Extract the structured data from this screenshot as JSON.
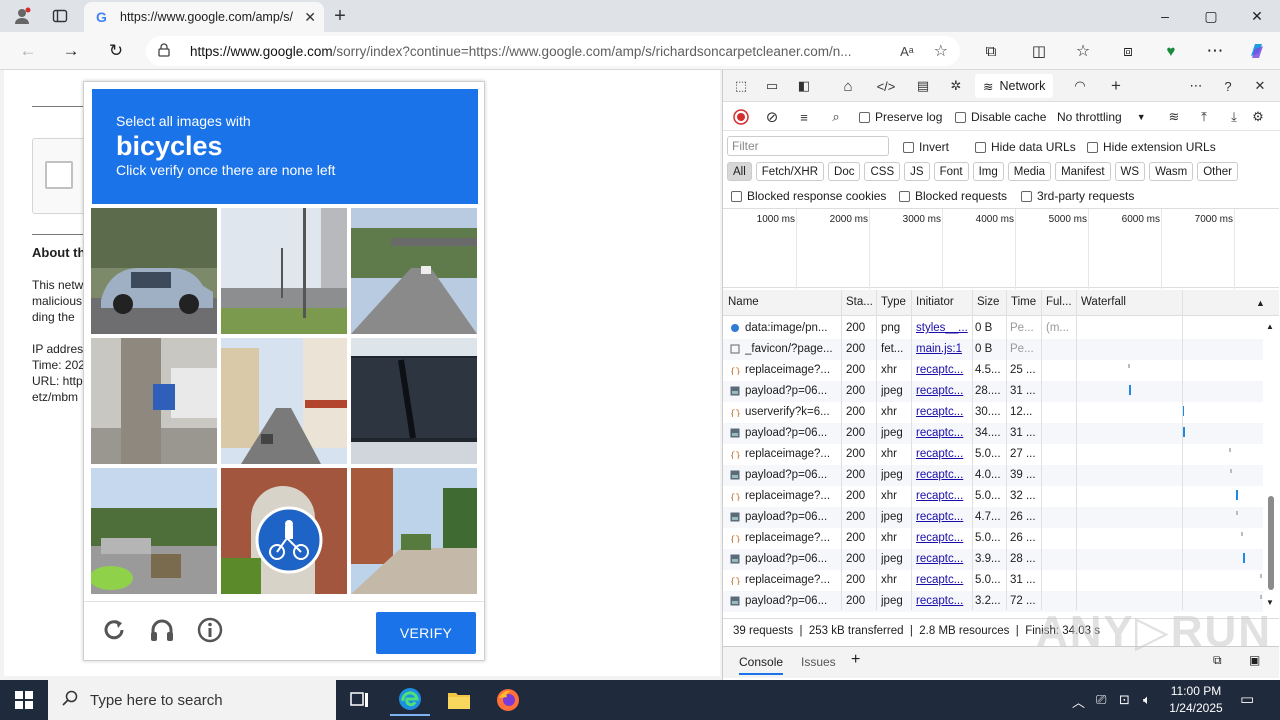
{
  "browser": {
    "tab_title": "https://www.google.com/amp/s/",
    "tab_favicon": "G",
    "url_domain": "https://www.google.com",
    "url_path": "/sorry/index?continue=https://www.google.com/amp/s/richardsoncarpetcleaner.com/n...",
    "read_aloud": "Aᵃ",
    "window_min": "–",
    "window_max": "▢",
    "window_close": "✕"
  },
  "page": {
    "heading": "About th",
    "lines": [
      "This netw",
      "malicious",
      "ding the",
      "",
      "IP addres",
      "Time: 202",
      "URL: http",
      "etz/mbm"
    ]
  },
  "captcha": {
    "instruction": "Select all images with",
    "target": "bicycles",
    "hint": "Click verify once there are none left",
    "verify_label": "VERIFY"
  },
  "devtools": {
    "network_tab": "Network",
    "preserve_log": "Preserve log",
    "disable_cache": "Disable cache",
    "throttling": "No throttling",
    "filter_placeholder": "Filter",
    "invert": "Invert",
    "hide_data_urls": "Hide data URLs",
    "hide_extension_urls": "Hide extension URLs",
    "types": [
      "All",
      "Fetch/XHR",
      "Doc",
      "CSS",
      "JS",
      "Font",
      "Img",
      "Media",
      "Manifest",
      "WS",
      "Wasm",
      "Other"
    ],
    "blocked_response_cookies": "Blocked response cookies",
    "blocked_requests": "Blocked requests",
    "third_party": "3rd-party requests",
    "timeline": [
      "1000 ms",
      "2000 ms",
      "3000 ms",
      "4000 ms",
      "5000 ms",
      "6000 ms",
      "7000 ms"
    ],
    "columns": [
      "Name",
      "Sta...",
      "Type",
      "Initiator",
      "Size",
      "Time",
      "Ful...",
      "Waterfall"
    ],
    "rows": [
      {
        "name": "data:image/pn...",
        "status": "200",
        "type": "png",
        "initiator": "styles__...",
        "size": "0 B",
        "time": "Pe...",
        "full": "(m...",
        "icon": "data"
      },
      {
        "name": "_favicon/?page...",
        "status": "200",
        "type": "fet...",
        "initiator": "main.js:1",
        "size": "0 B",
        "time": "Pe...",
        "full": "",
        "icon": "doc"
      },
      {
        "name": "replaceimage?...",
        "status": "200",
        "type": "xhr",
        "initiator": "recaptc...",
        "size": "4.5...",
        "time": "25 ...",
        "full": "",
        "icon": "xhr"
      },
      {
        "name": "payload?p=06...",
        "status": "200",
        "type": "jpeg",
        "initiator": "recaptc...",
        "size": "28....",
        "time": "31 ...",
        "full": "",
        "icon": "img"
      },
      {
        "name": "userverify?k=6...",
        "status": "200",
        "type": "xhr",
        "initiator": "recaptc...",
        "size": "30....",
        "time": "12...",
        "full": "",
        "icon": "xhr"
      },
      {
        "name": "payload?p=06...",
        "status": "200",
        "type": "jpeg",
        "initiator": "recaptc...",
        "size": "34....",
        "time": "31 ...",
        "full": "",
        "icon": "img"
      },
      {
        "name": "replaceimage?...",
        "status": "200",
        "type": "xhr",
        "initiator": "recaptc...",
        "size": "5.0...",
        "time": "27 ...",
        "full": "",
        "icon": "xhr"
      },
      {
        "name": "payload?p=06...",
        "status": "200",
        "type": "jpeg",
        "initiator": "recaptc...",
        "size": "4.0...",
        "time": "39 ...",
        "full": "",
        "icon": "img"
      },
      {
        "name": "replaceimage?...",
        "status": "200",
        "type": "xhr",
        "initiator": "recaptc...",
        "size": "5.0...",
        "time": "32 ...",
        "full": "",
        "icon": "xhr"
      },
      {
        "name": "payload?p=06...",
        "status": "200",
        "type": "jpeg",
        "initiator": "recaptc...",
        "size": "4.7...",
        "time": "26 ...",
        "full": "",
        "icon": "img"
      },
      {
        "name": "replaceimage?...",
        "status": "200",
        "type": "xhr",
        "initiator": "recaptc...",
        "size": "5.0...",
        "time": "26 ...",
        "full": "",
        "icon": "xhr"
      },
      {
        "name": "payload?p=06...",
        "status": "200",
        "type": "jpeg",
        "initiator": "recaptc...",
        "size": "3.9...",
        "time": "28 ...",
        "full": "",
        "icon": "img"
      },
      {
        "name": "replaceimage?...",
        "status": "200",
        "type": "xhr",
        "initiator": "recaptc...",
        "size": "5.0...",
        "time": "31 ...",
        "full": "",
        "icon": "xhr"
      },
      {
        "name": "payload?p=06...",
        "status": "200",
        "type": "jpeg",
        "initiator": "recaptc...",
        "size": "3.2...",
        "time": "72 ...",
        "full": "",
        "icon": "img"
      }
    ],
    "status_requests": "39 requests",
    "status_transferred": "253 kB transferred",
    "status_resources": "2.8 MB resources",
    "status_finish": "Finish: 34.03 s",
    "console_tab": "Console",
    "issues_tab": "Issues"
  },
  "watermark": "ANY▷RUN",
  "taskbar": {
    "search_placeholder": "Type here to search",
    "time": "11:00 PM",
    "date": "1/24/2025"
  },
  "colors": {
    "captcha_blue": "#1a73e8",
    "taskbar": "#1f2a3c",
    "link": "#1a0dab"
  }
}
